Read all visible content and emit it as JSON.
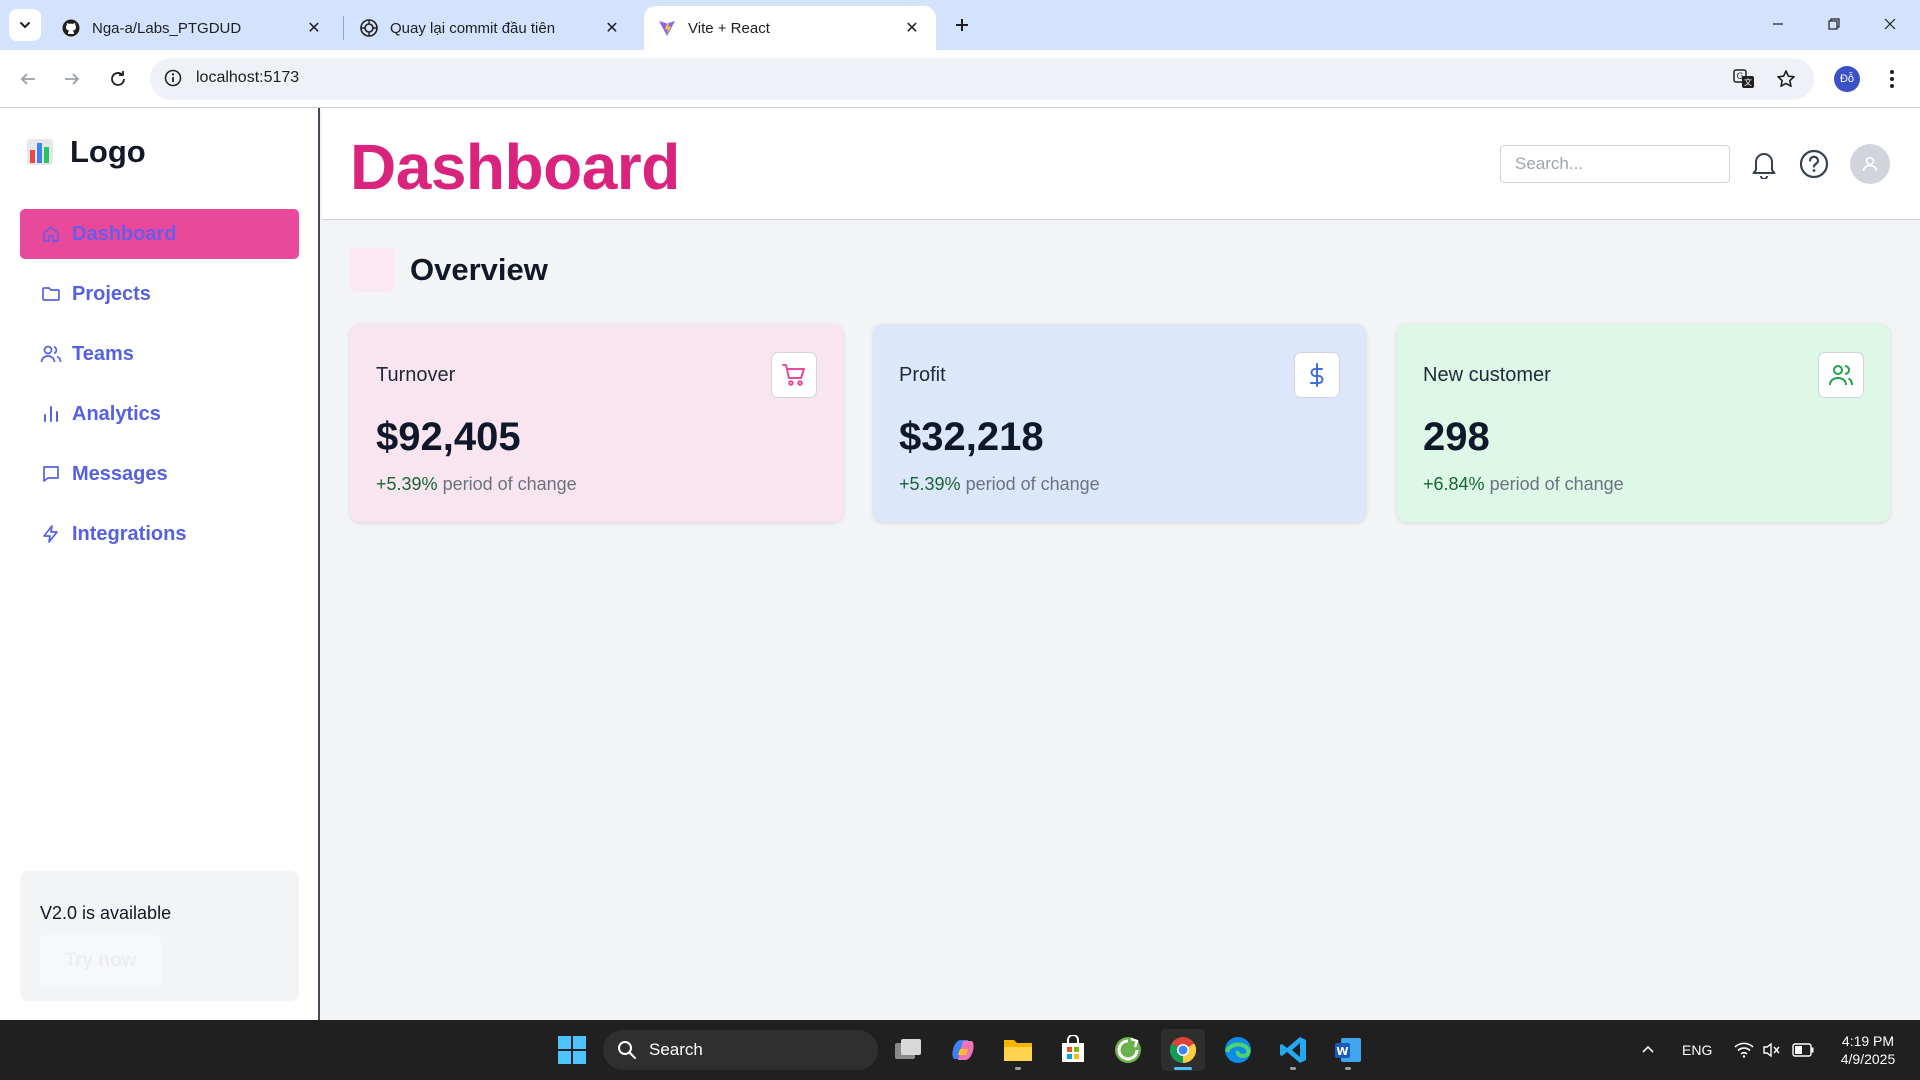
{
  "browser": {
    "tabs": [
      {
        "title": "Nga-a/Labs_PTGDUD",
        "icon": "github-icon"
      },
      {
        "title": "Quay lại commit đầu tiên",
        "icon": "chatgpt-icon"
      },
      {
        "title": "Vite + React",
        "icon": "vite-icon",
        "active": true
      }
    ],
    "url": "localhost:5173",
    "profile_initials": "Đỗ"
  },
  "sidebar": {
    "logo_text": "Logo",
    "items": [
      {
        "label": "Dashboard",
        "icon": "home-icon",
        "active": true
      },
      {
        "label": "Projects",
        "icon": "folder-icon"
      },
      {
        "label": "Teams",
        "icon": "users-icon"
      },
      {
        "label": "Analytics",
        "icon": "bar-chart-icon"
      },
      {
        "label": "Messages",
        "icon": "message-icon"
      },
      {
        "label": "Integrations",
        "icon": "bolt-icon"
      }
    ],
    "promo": {
      "title": "V2.0 is available",
      "button": "Try now"
    }
  },
  "header": {
    "title": "Dashboard",
    "search_placeholder": "Search..."
  },
  "overview": {
    "title": "Overview",
    "cards": [
      {
        "label": "Turnover",
        "value": "$92,405",
        "change": "+5.39%",
        "change_text": " period of change",
        "icon": "cart-icon",
        "bg": "#f9e5ef",
        "icon_color": "#e8499b"
      },
      {
        "label": "Profit",
        "value": "$32,218",
        "change": "+5.39%",
        "change_text": " period of change",
        "icon": "dollar-icon",
        "bg": "#dde7fb",
        "icon_color": "#3b6fd9"
      },
      {
        "label": "New customer",
        "value": "298",
        "change": "+6.84%",
        "change_text": " period of change",
        "icon": "users-icon",
        "bg": "#ddf8e6",
        "icon_color": "#22a04b"
      }
    ]
  },
  "taskbar": {
    "search_label": "Search",
    "language": "ENG",
    "time": "4:19 PM",
    "date": "4/9/2025"
  },
  "colors": {
    "accent": "#d9237c",
    "nav_text": "#5561e0",
    "active_nav_bg": "#e8499b"
  }
}
